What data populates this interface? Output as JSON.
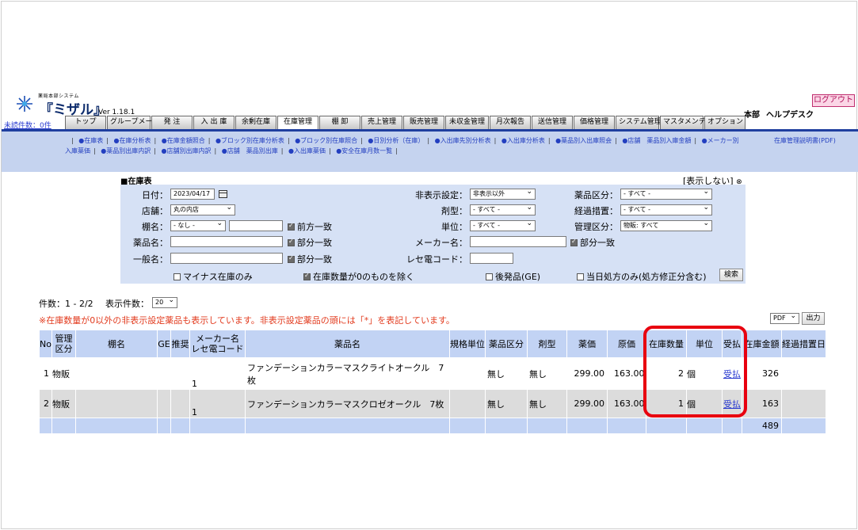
{
  "header": {
    "logo_small": "薬局本部システム",
    "logo_big": "『ミザル』",
    "version": "Ver 1.18.1",
    "unread": "未読件数：0件",
    "store": "本部",
    "helpdesk": "ヘルプデスク",
    "logout": "ログアウト"
  },
  "tabs": [
    "トップ",
    "グループメール",
    "発 注",
    "入 出 庫",
    "余剰在庫",
    "在庫管理",
    "棚 卸",
    "売上管理",
    "販売管理",
    "未収金管理",
    "月次報告",
    "送信管理",
    "価格管理",
    "システム管理",
    "マスタメンテ",
    "オプション"
  ],
  "active_tab": "在庫管理",
  "subnav": {
    "row1": [
      "●在庫表",
      "●在庫分析表",
      "●在庫金額照合",
      "●ブロック別在庫分析表",
      "●ブロック別在庫照合",
      "●日別分析（在庫）",
      "●入出庫先別分析表",
      "●入出庫分析表",
      "●薬品別入出庫照会",
      "●店舗　薬品別入庫金額",
      "●メーカー別"
    ],
    "row1_right": "在庫管理説明書(PDF)",
    "row2": [
      "入庫薬価",
      "●薬品別出庫内訳",
      "●店舗別出庫内訳",
      "●店舗　薬品別出庫",
      "●入出庫薬価",
      "●安全在庫月数一覧"
    ]
  },
  "panel": {
    "title": "■在庫表",
    "toggle": "[表示しない]",
    "date_label": "日付：",
    "date_value": "2023/04/17",
    "store_label": "店舗：",
    "store_value": "丸の内店",
    "shelf_label": "棚名：",
    "shelf_value": "- なし -",
    "prefix_match": "前方一致",
    "drug_label": "薬品名：",
    "partial1": "部分一致",
    "generic_label": "一般名：",
    "partial2": "部分一致",
    "hide_label": "非表示設定：",
    "hide_value": "非表示以外",
    "form_label": "剤型：",
    "form_value": "- すべて -",
    "unit_label": "単位：",
    "unit_value": "- すべて -",
    "maker_label": "メーカー名：",
    "partial3": "部分一致",
    "rece_label": "レセ電コード：",
    "cat_label": "薬品区分：",
    "cat_value": "- すべて -",
    "transition_label": "経過措置：",
    "transition_value": "- すべて -",
    "mgmt_label": "管理区分：",
    "mgmt_value": "物販: すべて",
    "minus_only": "マイナス在庫のみ",
    "exclude_zero": "在庫数量が0のものを除く",
    "generic_after": "後発品(GE)",
    "today_rx": "当日処方のみ(処方修正分含む)",
    "search_button": "検索"
  },
  "results": {
    "count": "件数：1 - 2/2",
    "display_label": "表示件数：",
    "display_value": "20",
    "notice": "※在庫数量が0以外の非表示設定薬品も表示しています。非表示設定薬品の頭には「*」を表記しています。",
    "export_format": "PDF",
    "export_button": "出力"
  },
  "table": {
    "headers": [
      "No",
      "管理区分",
      "棚名",
      "GE",
      "推奨",
      "メーカー名\nレセ電コード",
      "薬品名",
      "規格単位",
      "薬品区分",
      "剤型",
      "薬価",
      "原価",
      "在庫数量",
      "単位",
      "受払",
      "在庫金額",
      "経過措置日"
    ],
    "rows": [
      {
        "no": "1",
        "mgmt": "物販",
        "shelf": "",
        "ge": "",
        "rec": "",
        "code": "1",
        "drug": "ファンデーションカラーマスクライトオークル　7枚",
        "spec": "",
        "cat": "無し",
        "form": "無し",
        "price": "299.00",
        "cost": "163.00",
        "qty": "2",
        "unit": "個",
        "ledger": "受払",
        "amount": "326",
        "transition": ""
      },
      {
        "no": "2",
        "mgmt": "物販",
        "shelf": "",
        "ge": "",
        "rec": "",
        "code": "1",
        "drug": "ファンデーションカラーマスクロゼオークル　7枚",
        "spec": "",
        "cat": "無し",
        "form": "無し",
        "price": "299.00",
        "cost": "163.00",
        "qty": "1",
        "unit": "個",
        "ledger": "受払",
        "amount": "163",
        "transition": ""
      }
    ],
    "total_amount": "489"
  },
  "colors": {
    "accent": "#1f3f9f",
    "header_bg": "#c2d3f4",
    "warning": "#e23a1d",
    "highlight": "#e8000f"
  }
}
